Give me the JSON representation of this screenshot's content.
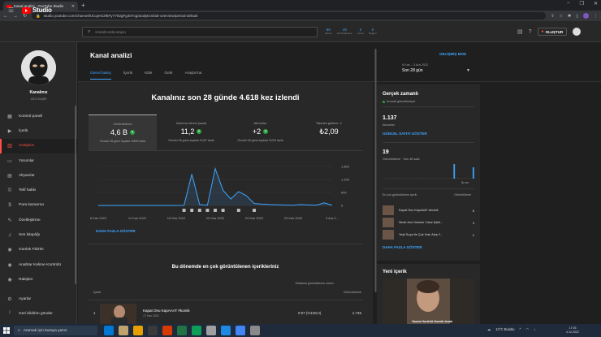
{
  "browser": {
    "tab_title": "Kanal analizi - YouTube Studio",
    "url": "studio.youtube.com/channel/UCqeIG2f6FyY782gFg407og/analytics/tab-overview/period-default"
  },
  "header": {
    "logo_text": "Studio",
    "search_placeholder": "Kanalınızda arayın",
    "stats": [
      {
        "value": "60",
        "label": "Abone"
      },
      {
        "value": "19",
        "label": "Görüntülenme"
      },
      {
        "value": "2",
        "label": "Yorum"
      },
      {
        "value": "0",
        "label": "Beğeni"
      }
    ],
    "create_label": "OLUŞTUR"
  },
  "sidebar": {
    "channel_label": "Kanalınız",
    "channel_name": "OZCİ KAŞRI",
    "items": [
      {
        "label": "Kontrol paneli",
        "icon": "dashboard-icon"
      },
      {
        "label": "İçerik",
        "icon": "content-icon"
      },
      {
        "label": "Analytics",
        "icon": "analytics-icon",
        "active": true
      },
      {
        "label": "Yorumlar",
        "icon": "comments-icon"
      },
      {
        "label": "Altyazılar",
        "icon": "subtitles-icon"
      },
      {
        "label": "Telif hakkı",
        "icon": "copyright-icon"
      },
      {
        "label": "Para kazanma",
        "icon": "monetization-icon"
      },
      {
        "label": "Özelleştirme",
        "icon": "customization-icon"
      },
      {
        "label": "Ses kitaplığı",
        "icon": "audio-library-icon"
      },
      {
        "label": "Günlük Fikirler",
        "icon": "ideas-icon"
      },
      {
        "label": "Anahtar Kelime Kontrolü",
        "icon": "keyword-icon"
      },
      {
        "label": "Rakipler",
        "icon": "competitors-icon"
      }
    ],
    "bottom_items": [
      {
        "label": "Ayarlar",
        "icon": "settings-icon"
      },
      {
        "label": "Geri bildirim gönder",
        "icon": "feedback-icon"
      }
    ]
  },
  "page": {
    "title": "Kanal analizi",
    "advanced_mode": "GELİŞMİŞ MOD",
    "tabs": [
      {
        "label": "Genel bakış",
        "active": true
      },
      {
        "label": "İçerik"
      },
      {
        "label": "Kitle"
      },
      {
        "label": "Gelir"
      },
      {
        "label": "Araştırma"
      }
    ],
    "date_range": "6 Kas – 3 Ara 2022",
    "date_period": "Son 28 gün"
  },
  "overview": {
    "headline": "Kanalınız son 28 günde 4.618 kez izlendi",
    "metrics": [
      {
        "label": "Görüntüleme",
        "value": "4,6 B",
        "up": true,
        "compare": "Önceki 28 güne kıyasla %899 fazla"
      },
      {
        "label": "İzlenme süresi (saat)",
        "value": "11,2",
        "up": true,
        "compare": "Önceki 28 güne kıyasla %167 fazla"
      },
      {
        "label": "Aboneler",
        "value": "+2",
        "up": true,
        "compare": "Önceki 28 güne kıyasla %200 fazla"
      },
      {
        "label": "Tahmini gelirniz",
        "value": "₺2,09",
        "up": false,
        "compare": ""
      }
    ],
    "show_more": "DAHA FAZLA GÖSTER"
  },
  "chart_data": {
    "type": "line",
    "x": [
      "6 Kas 2022",
      "11 Kas 2022",
      "15 Kas 2022",
      "20 Kas 2022",
      "24 Kas 2022",
      "29 Kas 2022",
      "3 Ara 2..."
    ],
    "ylabels": [
      "1.800",
      "1.200",
      "600",
      "0"
    ],
    "ylim": [
      0,
      1800
    ],
    "series": [
      {
        "values": [
          0,
          0,
          0,
          0,
          0,
          0,
          0,
          0,
          0,
          0,
          0,
          5,
          1450,
          40,
          10,
          1700,
          700,
          300,
          640,
          450,
          90,
          60,
          40,
          30,
          20,
          10,
          40,
          20,
          15,
          120,
          5
        ]
      }
    ],
    "color": "#3ea6ff"
  },
  "top_content": {
    "title": "Bu dönemde en çok görüntülenen içerikleriniz",
    "col_content": "İçerik",
    "col_avg": "Ortalama görüntülenme süresi",
    "col_views": "Görüntüleme",
    "rows": [
      {
        "index": "1",
        "title": "Kapat Onu KapAAAT #komik",
        "date": "17 Kas 2022",
        "avg": "0:07 (%100,0)",
        "views": "1.746"
      }
    ]
  },
  "realtime": {
    "title": "Gerçek zamanlı",
    "live_label": "Anında güncelleniyor",
    "subscribers": "1.137",
    "subscribers_label": "Aboneler",
    "live_count_button": "GÜNCEL SAYIYI GÖSTER",
    "views": "19",
    "views_label": "Görüntüleme · Son 48 saat",
    "bars": [
      0,
      0,
      0,
      0,
      0,
      0,
      0,
      0,
      0,
      0,
      0,
      0,
      0,
      0,
      0,
      0,
      0,
      0,
      0,
      0,
      0,
      0,
      0,
      0,
      0,
      0,
      0,
      0,
      0,
      0,
      0,
      0,
      0,
      0,
      0,
      0,
      0,
      9,
      0,
      0,
      0,
      0,
      0,
      0,
      0,
      0,
      0,
      7
    ],
    "now_label": "Şu an",
    "top_label": "En çok görüntülenen içerik",
    "top_views_label": "Görüntüleme",
    "items": [
      {
        "title": "Kapat Onu KapAAAT #komik",
        "views": "8"
      },
      {
        "title": "Simle Ann Üzerine Yıldız Şakil...",
        "views": "3"
      },
      {
        "title": "Yeşli Sopa İle Çok Hızlı Ateş Y...",
        "views": "2"
      }
    ]
  },
  "new_content": {
    "title": "Yeni içerik",
    "caption": "Yaoma HocAAA #komik #ozah"
  },
  "taskbar": {
    "search_placeholder": "Aramak için buraya yazın",
    "weather": "13°C  Bulutlu",
    "time": "17:26",
    "date": "4.12.2022",
    "apps": [
      "#0078d4",
      "#c1a36e",
      "#e6a100",
      "#3a3a3a",
      "#d83b01",
      "#217346",
      "#0f9d58",
      "#a0a0a0",
      "#1e88e5",
      "#4285f4",
      "#8a8a8a"
    ]
  }
}
